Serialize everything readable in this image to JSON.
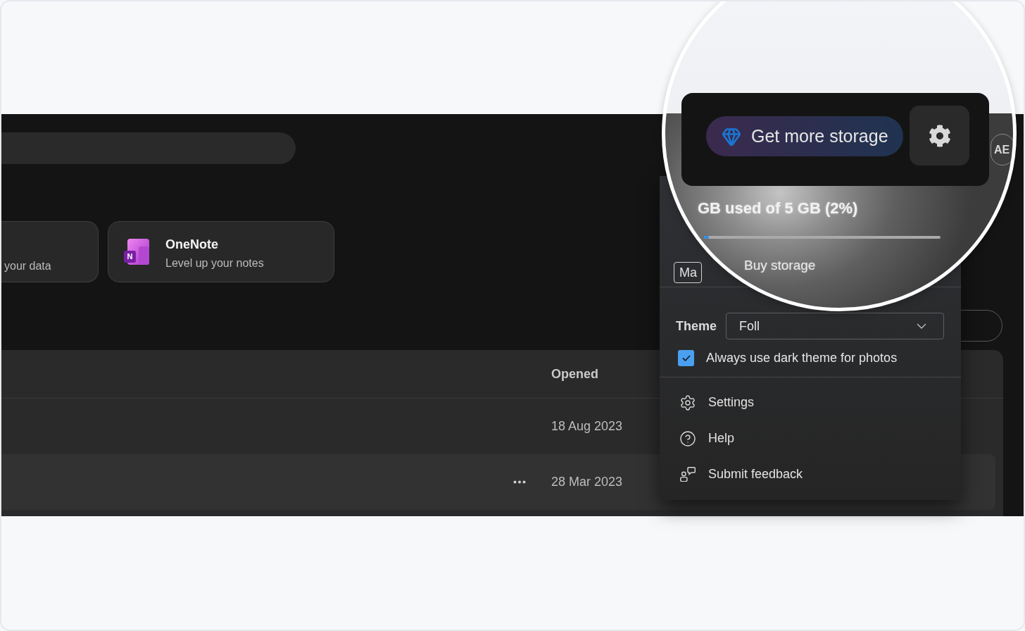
{
  "cards": [
    {
      "kind": "clipped",
      "subtitle": "your data"
    },
    {
      "kind": "app",
      "logo_letter": "N",
      "title": "OneNote",
      "subtitle": "Level up your notes"
    }
  ],
  "table": {
    "columns": [
      "Opened"
    ],
    "rows": [
      {
        "opened": "18 Aug 2023",
        "hovered": false
      },
      {
        "opened": "28 Mar 2023",
        "hovered": true
      }
    ]
  },
  "menu": {
    "storage_button": "Ma",
    "theme": {
      "label": "Theme",
      "value": "Foll"
    },
    "dark_photos": {
      "label": "Always use dark theme for photos",
      "checked": true
    },
    "items": [
      {
        "kind": "settings",
        "label": "Settings"
      },
      {
        "kind": "help",
        "label": "Help"
      },
      {
        "kind": "feedback",
        "label": "Submit feedback"
      }
    ]
  },
  "magnifier": {
    "upgrade_button": "Get more storage",
    "avatar_initials": "AE",
    "storage": {
      "usage": "GB used of 5 GB (2%)",
      "level": 0.02,
      "link": "Buy storage"
    }
  }
}
